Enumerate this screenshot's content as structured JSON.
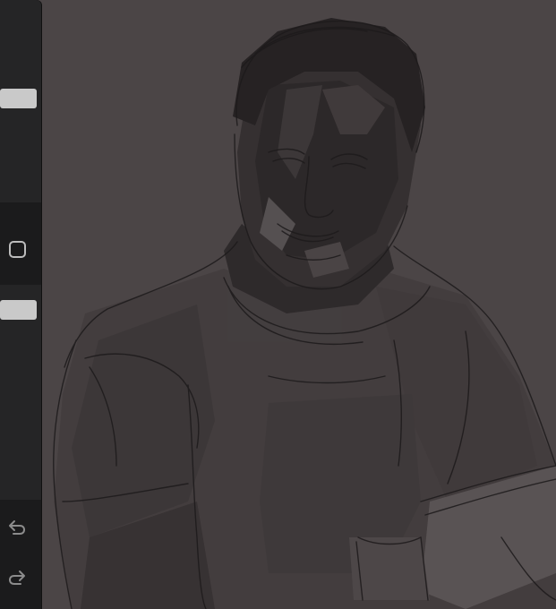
{
  "app": {
    "canvas_background": "#4b4546",
    "sidebar_color": "#1b1b1c",
    "knob_color": "#c9c9c9"
  },
  "sidebar": {
    "brush_size": {
      "level": 0.45
    },
    "modify_button": {
      "icon": "square-icon"
    },
    "opacity": {
      "level": 0.93
    },
    "undo": {
      "icon": "undo-icon"
    },
    "redo": {
      "icon": "redo-icon"
    }
  },
  "artwork": {
    "subject": "sketch-portrait",
    "palette": [
      "#4b4546",
      "#3a3536",
      "#2f2b2c",
      "#5e5859",
      "#6a6465",
      "#1f1c1d"
    ]
  }
}
